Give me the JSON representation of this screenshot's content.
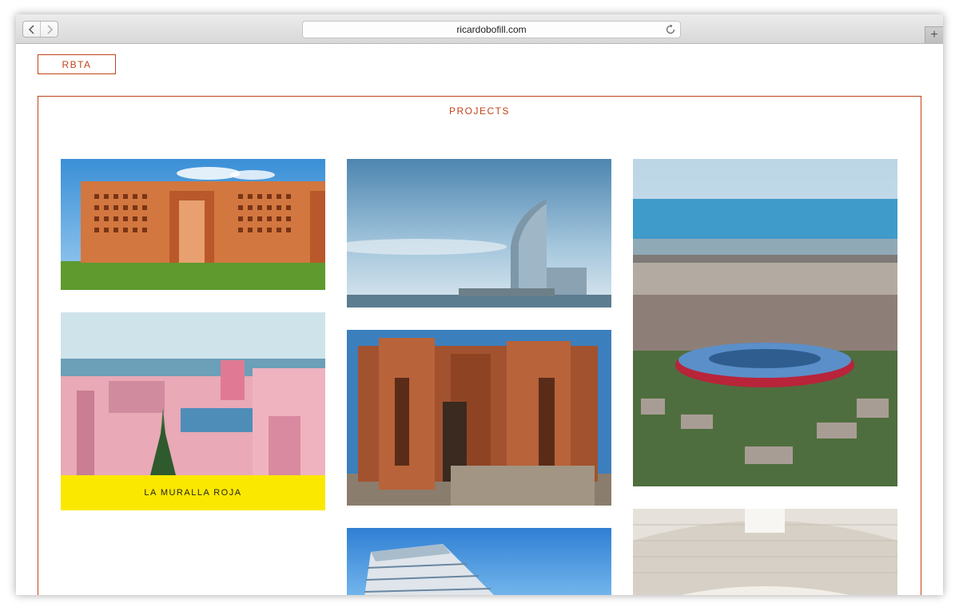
{
  "browser": {
    "url": "ricardobofill.com",
    "back_icon": "chevron-left-icon",
    "forward_icon": "chevron-right-icon",
    "reload_icon": "reload-icon",
    "new_tab_icon": "plus-icon",
    "new_tab_label": "+"
  },
  "site": {
    "logo": "RBTA",
    "section_title": "PROJECTS",
    "accent_color": "#c0441a",
    "caption_color": "#fbe800"
  },
  "projects": [
    {
      "image": "terracotta-building-with-grid-windows"
    },
    {
      "image": "pink-terraces-by-the-sea",
      "caption": "LA MURALLA ROJA"
    },
    {
      "image": "sail-shaped-hotel-tower-on-coast"
    },
    {
      "image": "brick-tower-cluster"
    },
    {
      "image": "glass-office-building"
    },
    {
      "image": "city-panorama-with-stadium"
    },
    {
      "image": "vaulted-white-interior"
    }
  ]
}
